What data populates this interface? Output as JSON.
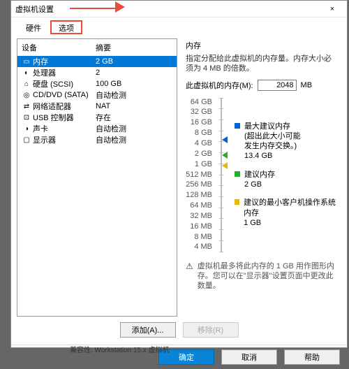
{
  "window": {
    "title": "虚拟机设置",
    "close": "×"
  },
  "tabs": {
    "hardware": "硬件",
    "options": "选项"
  },
  "list": {
    "header_device": "设备",
    "header_summary": "摘要",
    "items": [
      {
        "icon": "▭",
        "name": "内存",
        "value": "2 GB",
        "selected": true
      },
      {
        "icon": "◐",
        "name": "处理器",
        "value": "2"
      },
      {
        "icon": "⌂",
        "name": "硬盘 (SCSI)",
        "value": "100 GB"
      },
      {
        "icon": "◎",
        "name": "CD/DVD (SATA)",
        "value": "自动检测"
      },
      {
        "icon": "⇄",
        "name": "网络适配器",
        "value": "NAT"
      },
      {
        "icon": "⊡",
        "name": "USB 控制器",
        "value": "存在"
      },
      {
        "icon": "◑",
        "name": "声卡",
        "value": "自动检测"
      },
      {
        "icon": "▢",
        "name": "显示器",
        "value": "自动检测"
      }
    ]
  },
  "memory": {
    "section": "内存",
    "desc": "指定分配给此虚拟机的内存量。内存大小必须为 4 MB 的倍数。",
    "label": "此虚拟机的内存(M):",
    "value": "2048",
    "unit": "MB",
    "ticks": [
      "64 GB",
      "32 GB",
      "16 GB",
      "8 GB",
      "4 GB",
      "2 GB",
      "1 GB",
      "512 MB",
      "256 MB",
      "128 MB",
      "64 MB",
      "32 MB",
      "16 MB",
      "8 MB",
      "4 MB"
    ],
    "legend": {
      "max": {
        "label": "最大建议内存",
        "note1": "(超出此大小可能",
        "note2": "发生内存交换。)",
        "value": "13.4 GB",
        "color": "#0066cc"
      },
      "rec": {
        "label": "建议内存",
        "value": "2 GB",
        "color": "#2aad2a"
      },
      "min": {
        "label": "建议的最小客户机操作系统内存",
        "value": "1 GB",
        "color": "#e8b800"
      }
    },
    "bottom_note": "虚拟机最多将此内存的 1 GB 用作图形内存。您可以在\"显示器\"设置页面中更改此数量。"
  },
  "buttons": {
    "add": "添加(A)...",
    "remove": "移除(R)"
  },
  "footer": {
    "ok": "确定",
    "cancel": "取消",
    "help": "帮助"
  },
  "status": "兼容性: Workstation 15.x 虚拟机"
}
